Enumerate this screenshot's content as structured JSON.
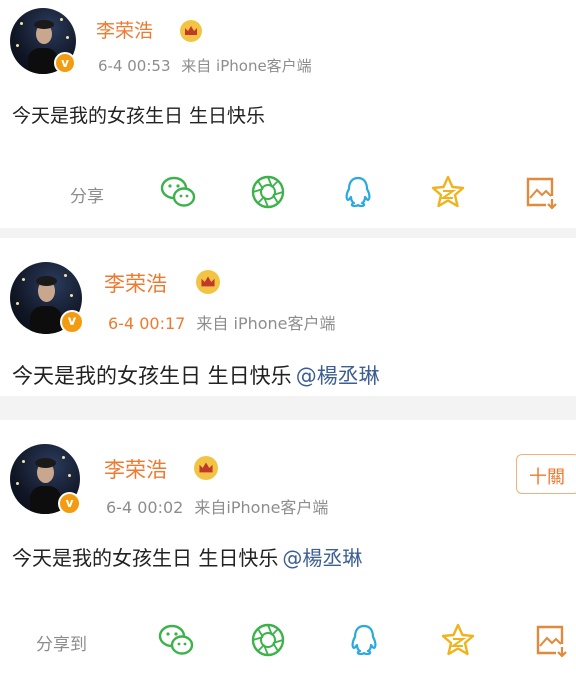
{
  "posts": [
    {
      "author": "李荣浩",
      "date": "6-4 00:53",
      "source": "来自 iPhone客户端",
      "text": "今天是我的女孩生日 生日快乐",
      "mention": "",
      "share_label": "分享"
    },
    {
      "author": "李荣浩",
      "date": "6-4 00:17",
      "source": "来自 iPhone客户端",
      "text": "今天是我的女孩生日 生日快乐",
      "mention": "@楊丞琳",
      "share_label": ""
    },
    {
      "author": "李荣浩",
      "date": "6-4 00:02",
      "source": "来自iPhone客户端",
      "text": "今天是我的女孩生日 生日快乐",
      "mention": "@楊丞琳",
      "share_label": "分享到",
      "follow_label": "十關"
    }
  ],
  "icons": {
    "wechat": "wechat-icon",
    "moments": "moments-icon",
    "qq": "qq-icon",
    "qzone": "qzone-star-icon",
    "save": "save-image-icon",
    "verified": "verified-v-icon",
    "crown": "crown-badge-icon"
  },
  "colors": {
    "author_name": "#ee7a30",
    "mention": "#3d5e93",
    "meta_text": "#8d8d8d",
    "wechat_green": "#3cb34a",
    "qq_blue": "#2aa8e0",
    "star_yellow": "#f1b31c"
  }
}
